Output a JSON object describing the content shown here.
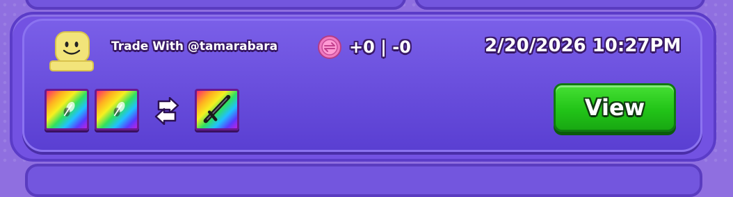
{
  "trade": {
    "label": "Trade With @tamarabara",
    "value_text": "+0 | -0",
    "timestamp": "2/20/2026 10:27PM",
    "view_label": "View"
  },
  "icons": {
    "avatar": "roblox-default-avatar-icon",
    "coin": "pink-gem-coin-icon",
    "swap": "swap-arrows-icon",
    "items": [
      "rainbow-pet-item-icon",
      "rainbow-pet-item-icon",
      "rainbow-sword-item-icon"
    ]
  },
  "colors": {
    "card_bg": "#6a4fe0",
    "view_button": "#2ccc1e",
    "outline": "#3a1a6a"
  }
}
